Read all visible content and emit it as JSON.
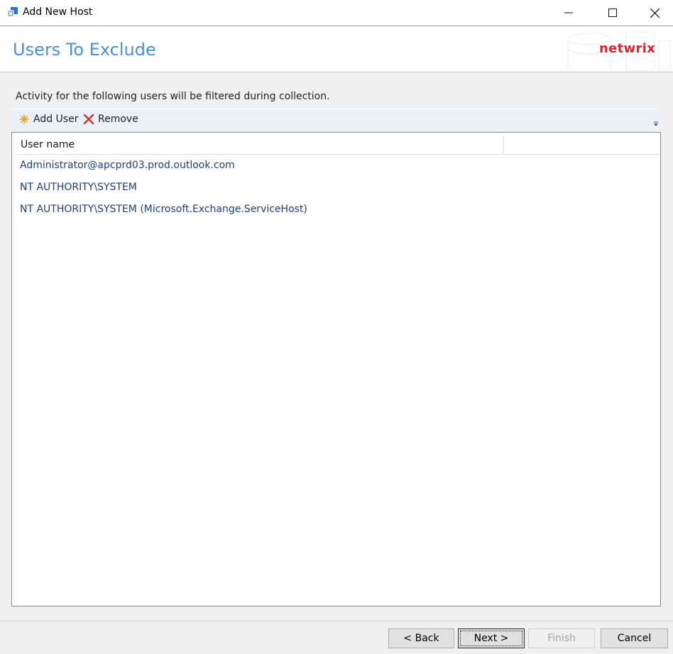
{
  "window": {
    "title": "Add New Host"
  },
  "header": {
    "page_title": "Users To Exclude",
    "logo_text": "netwrix"
  },
  "description": "Activity for the following users will be filtered during collection.",
  "toolbar": {
    "add_label": "Add User",
    "remove_label": "Remove"
  },
  "grid": {
    "columns": [
      "User name",
      ""
    ],
    "rows": [
      "Administrator@apcprd03.prod.outlook.com",
      "NT AUTHORITY\\SYSTEM",
      "NT AUTHORITY\\SYSTEM (Microsoft.Exchange.ServiceHost)"
    ]
  },
  "buttons": {
    "back": "< Back",
    "next": "Next >",
    "finish": "Finish",
    "cancel": "Cancel"
  },
  "colors": {
    "accent_title": "#4a8fd8",
    "logo_red": "#d7262e",
    "row_text": "#1f3f7a",
    "toolbar_bg": "#eaf1f9"
  },
  "icons": {
    "app": "app-icon",
    "add": "asterisk-icon",
    "remove": "x-icon"
  }
}
